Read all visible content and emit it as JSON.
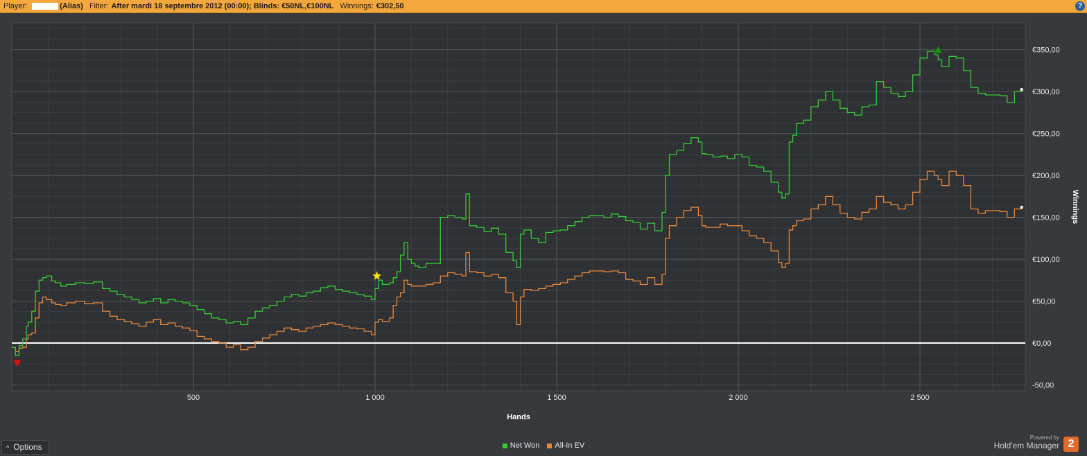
{
  "header": {
    "player_label": "Player:",
    "alias": "(Alias)",
    "filter_label": "Filter:",
    "filter_value": "After mardi 18 septembre 2012 (00:00); Blinds: €50NL,€100NL",
    "winnings_label": "Winnings:",
    "winnings_value": "€302,50",
    "help": "?"
  },
  "footer": {
    "options_label": "Options",
    "powered_by": "Powered by",
    "product": "Hold'em Manager",
    "product_badge": "2"
  },
  "colors": {
    "net_won": "#35cc35",
    "all_in_ev": "#e8893c",
    "zero_line": "#ffffff",
    "header_bg": "#f3a73d",
    "background": "#37393d"
  },
  "chart_data": {
    "type": "line",
    "xlabel": "Hands",
    "ylabel": "Winnings",
    "xlim": [
      0,
      2790
    ],
    "ylim": [
      -57,
      382
    ],
    "x_ticks": [
      500,
      1000,
      1500,
      2000,
      2500
    ],
    "x_tick_labels": [
      "500",
      "1 000",
      "1 500",
      "2 000",
      "2 500"
    ],
    "y_ticks": [
      -50,
      0,
      50,
      100,
      150,
      200,
      250,
      300,
      350
    ],
    "y_tick_labels": [
      "-50,00",
      "€0,00",
      "€50,00",
      "€100,00",
      "€150,00",
      "€200,00",
      "€250,00",
      "€300,00",
      "€350,00"
    ],
    "grid": true,
    "legend_position": "bottom-center",
    "markers": [
      {
        "kind": "min",
        "x": 15,
        "y": -24
      },
      {
        "kind": "max",
        "x": 2550,
        "y": 350
      },
      {
        "kind": "star",
        "x": 1005,
        "y": 80
      }
    ],
    "series": [
      {
        "name": "Net Won",
        "x": [
          0,
          10,
          20,
          30,
          40,
          45,
          55,
          65,
          75,
          85,
          95,
          110,
          120,
          135,
          150,
          175,
          200,
          225,
          250,
          270,
          290,
          310,
          330,
          350,
          370,
          390,
          410,
          430,
          450,
          470,
          490,
          510,
          530,
          550,
          570,
          590,
          610,
          630,
          650,
          670,
          690,
          710,
          730,
          750,
          770,
          790,
          810,
          830,
          850,
          870,
          890,
          910,
          930,
          950,
          970,
          990,
          1000,
          1010,
          1020,
          1040,
          1050,
          1060,
          1070,
          1080,
          1090,
          1100,
          1110,
          1120,
          1140,
          1160,
          1180,
          1200,
          1220,
          1240,
          1250,
          1260,
          1280,
          1300,
          1320,
          1340,
          1360,
          1380,
          1390,
          1400,
          1410,
          1430,
          1450,
          1470,
          1490,
          1510,
          1530,
          1550,
          1570,
          1590,
          1610,
          1630,
          1650,
          1670,
          1690,
          1710,
          1730,
          1750,
          1770,
          1790,
          1800,
          1810,
          1830,
          1850,
          1870,
          1890,
          1900,
          1910,
          1930,
          1950,
          1970,
          1990,
          2010,
          2030,
          2050,
          2070,
          2090,
          2110,
          2120,
          2130,
          2140,
          2150,
          2160,
          2180,
          2200,
          2220,
          2240,
          2260,
          2280,
          2300,
          2320,
          2340,
          2360,
          2380,
          2400,
          2420,
          2440,
          2460,
          2480,
          2500,
          2520,
          2540,
          2550,
          2560,
          2580,
          2600,
          2620,
          2640,
          2660,
          2680,
          2700,
          2720,
          2740,
          2760,
          2780
        ],
        "values": [
          -5,
          -15,
          -3,
          5,
          20,
          25,
          38,
          62,
          75,
          78,
          80,
          74,
          72,
          68,
          70,
          72,
          71,
          73,
          65,
          62,
          58,
          55,
          52,
          48,
          50,
          53,
          48,
          52,
          50,
          48,
          45,
          40,
          35,
          30,
          28,
          24,
          26,
          22,
          30,
          38,
          42,
          45,
          50,
          55,
          58,
          56,
          60,
          62,
          66,
          68,
          64,
          62,
          60,
          58,
          56,
          52,
          65,
          75,
          70,
          72,
          78,
          85,
          105,
          120,
          100,
          95,
          92,
          90,
          95,
          95,
          150,
          152,
          150,
          148,
          178,
          140,
          138,
          133,
          137,
          130,
          108,
          98,
          90,
          130,
          135,
          125,
          120,
          132,
          134,
          135,
          140,
          145,
          150,
          152,
          152,
          150,
          154,
          151,
          146,
          144,
          136,
          143,
          134,
          156,
          200,
          225,
          230,
          238,
          245,
          240,
          226,
          225,
          222,
          223,
          220,
          225,
          222,
          212,
          210,
          205,
          192,
          180,
          173,
          178,
          240,
          248,
          262,
          266,
          282,
          290,
          300,
          290,
          280,
          275,
          272,
          282,
          284,
          312,
          305,
          298,
          294,
          300,
          320,
          340,
          348,
          344,
          338,
          330,
          342,
          340,
          325,
          305,
          298,
          296,
          296,
          295,
          287,
          300,
          302.5
        ]
      },
      {
        "name": "All-In EV",
        "x": [
          0,
          10,
          20,
          30,
          40,
          45,
          55,
          65,
          75,
          85,
          95,
          110,
          120,
          135,
          150,
          175,
          200,
          225,
          250,
          270,
          290,
          310,
          330,
          350,
          370,
          390,
          410,
          430,
          450,
          470,
          490,
          510,
          530,
          550,
          570,
          590,
          610,
          630,
          650,
          670,
          690,
          710,
          730,
          750,
          770,
          790,
          810,
          830,
          850,
          870,
          890,
          910,
          930,
          950,
          970,
          990,
          1000,
          1010,
          1020,
          1040,
          1050,
          1060,
          1070,
          1080,
          1090,
          1100,
          1110,
          1120,
          1140,
          1160,
          1180,
          1200,
          1220,
          1240,
          1250,
          1260,
          1280,
          1300,
          1320,
          1340,
          1360,
          1380,
          1390,
          1400,
          1410,
          1430,
          1450,
          1470,
          1490,
          1510,
          1530,
          1550,
          1570,
          1590,
          1610,
          1630,
          1650,
          1670,
          1690,
          1710,
          1730,
          1750,
          1770,
          1790,
          1800,
          1810,
          1830,
          1850,
          1870,
          1890,
          1900,
          1910,
          1930,
          1950,
          1970,
          1990,
          2010,
          2030,
          2050,
          2070,
          2090,
          2110,
          2120,
          2130,
          2140,
          2150,
          2160,
          2180,
          2200,
          2220,
          2240,
          2260,
          2280,
          2300,
          2320,
          2340,
          2360,
          2380,
          2400,
          2420,
          2440,
          2460,
          2480,
          2500,
          2520,
          2540,
          2550,
          2560,
          2580,
          2600,
          2620,
          2640,
          2660,
          2680,
          2700,
          2720,
          2740,
          2760,
          2780
        ],
        "values": [
          -5,
          -10,
          -6,
          -5,
          5,
          10,
          12,
          30,
          48,
          55,
          52,
          48,
          46,
          45,
          48,
          50,
          47,
          48,
          38,
          32,
          28,
          26,
          23,
          20,
          25,
          28,
          22,
          24,
          20,
          18,
          15,
          8,
          5,
          2,
          0,
          -5,
          -2,
          -8,
          -5,
          2,
          6,
          10,
          14,
          18,
          16,
          14,
          18,
          20,
          22,
          24,
          22,
          20,
          18,
          17,
          14,
          10,
          25,
          28,
          26,
          30,
          45,
          55,
          60,
          75,
          70,
          68,
          68,
          68,
          70,
          72,
          80,
          84,
          82,
          80,
          108,
          85,
          84,
          80,
          82,
          78,
          60,
          50,
          22,
          55,
          64,
          63,
          65,
          68,
          70,
          72,
          76,
          80,
          84,
          86,
          86,
          85,
          86,
          84,
          76,
          74,
          70,
          78,
          70,
          82,
          125,
          140,
          150,
          158,
          162,
          152,
          140,
          138,
          138,
          142,
          140,
          140,
          134,
          128,
          125,
          120,
          110,
          96,
          90,
          95,
          135,
          140,
          146,
          148,
          160,
          165,
          175,
          165,
          155,
          150,
          148,
          156,
          160,
          175,
          168,
          165,
          160,
          165,
          180,
          195,
          205,
          200,
          195,
          188,
          205,
          200,
          188,
          160,
          155,
          158,
          158,
          157,
          150,
          160,
          162
        ]
      }
    ]
  }
}
